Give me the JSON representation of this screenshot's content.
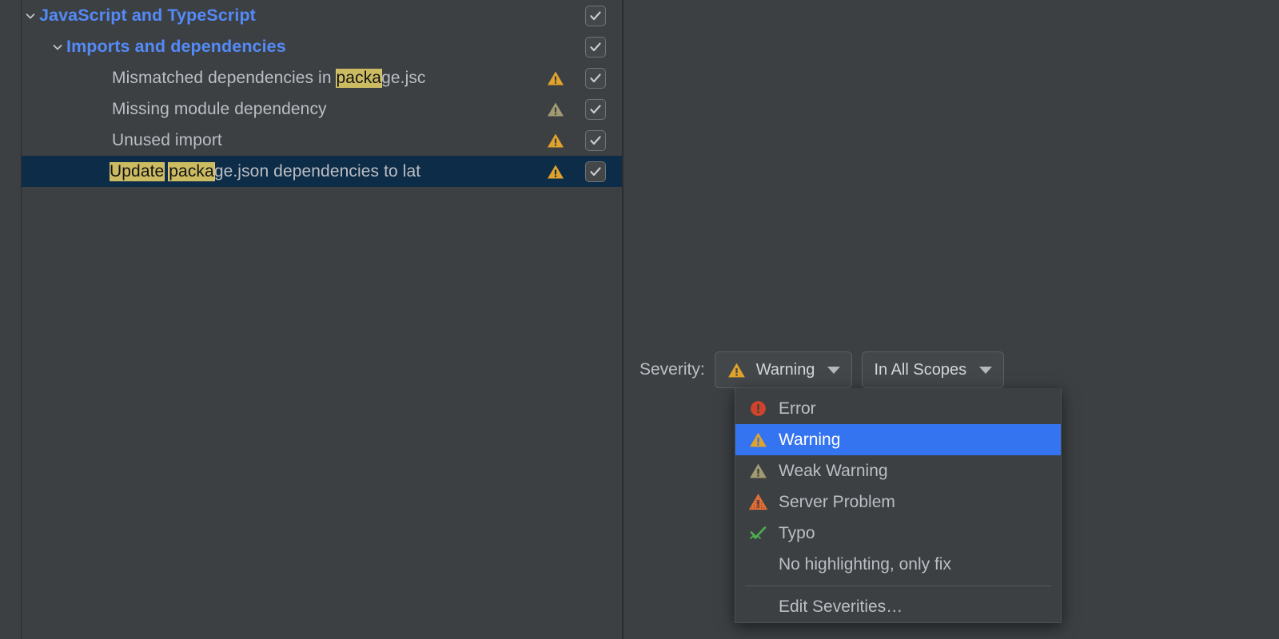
{
  "colors": {
    "background": "#3c4043",
    "tree_selection": "#0d2c47",
    "menu_selection": "#3574f0",
    "group_label": "#548af7",
    "text": "#bcbec4",
    "highlight_match": "#cdbb62",
    "warning_icon": "#e2a32b",
    "error_icon": "#d0432b",
    "weak_warning_icon": "#a29b72",
    "server_problem_icon": "#e8713a",
    "typo_icon": "#4fb04f"
  },
  "tree": {
    "rows": [
      {
        "label": "JavaScript and TypeScript",
        "kind": "group",
        "depth": 0,
        "expanded": true,
        "severity_icon": "none",
        "checked": true
      },
      {
        "label": "Imports and dependencies",
        "kind": "group",
        "depth": 1,
        "expanded": true,
        "severity_icon": "none",
        "checked": true
      },
      {
        "label": "Mismatched dependencies in package.jsc",
        "parts": [
          {
            "text": "Mismatched dependencies in ",
            "highlight": false
          },
          {
            "text": "packa",
            "highlight": true
          },
          {
            "text": "ge.jsc",
            "highlight": false
          }
        ],
        "kind": "inspection",
        "depth": 2,
        "severity_icon": "warning",
        "checked": true
      },
      {
        "label": "Missing module dependency",
        "parts": [
          {
            "text": "Missing module dependency",
            "highlight": false
          }
        ],
        "kind": "inspection",
        "depth": 2,
        "severity_icon": "weak-warning",
        "checked": true
      },
      {
        "label": "Unused import",
        "parts": [
          {
            "text": "Unused import",
            "highlight": false
          }
        ],
        "kind": "inspection",
        "depth": 2,
        "severity_icon": "warning",
        "checked": true
      },
      {
        "label": "Update package.json dependencies to lat",
        "parts": [
          {
            "text": "Update",
            "highlight": true
          },
          {
            "text": " ",
            "highlight": false
          },
          {
            "text": "packa",
            "highlight": true
          },
          {
            "text": "ge.json dependencies to lat",
            "highlight": false
          }
        ],
        "kind": "inspection",
        "depth": 2,
        "severity_icon": "warning",
        "checked": true,
        "selected": true
      }
    ]
  },
  "severity_bar": {
    "label": "Severity:",
    "severity_combo": {
      "value": "Warning",
      "icon": "warning-icon",
      "caret": "chevron-down-icon"
    },
    "scope_combo": {
      "value": "In All Scopes",
      "caret": "chevron-down-icon"
    }
  },
  "severity_menu": {
    "items": [
      {
        "label": "Error",
        "icon": "error-icon",
        "selected": false
      },
      {
        "label": "Warning",
        "icon": "warning-icon",
        "selected": true
      },
      {
        "label": "Weak Warning",
        "icon": "weak-warning-icon",
        "selected": false
      },
      {
        "label": "Server Problem",
        "icon": "server-problem-icon",
        "selected": false
      },
      {
        "label": "Typo",
        "icon": "typo-icon",
        "selected": false
      },
      {
        "label": "No highlighting, only fix",
        "icon": "none",
        "selected": false
      },
      {
        "separator": true
      },
      {
        "label": "Edit Severities…",
        "icon": "none",
        "selected": false
      }
    ]
  }
}
